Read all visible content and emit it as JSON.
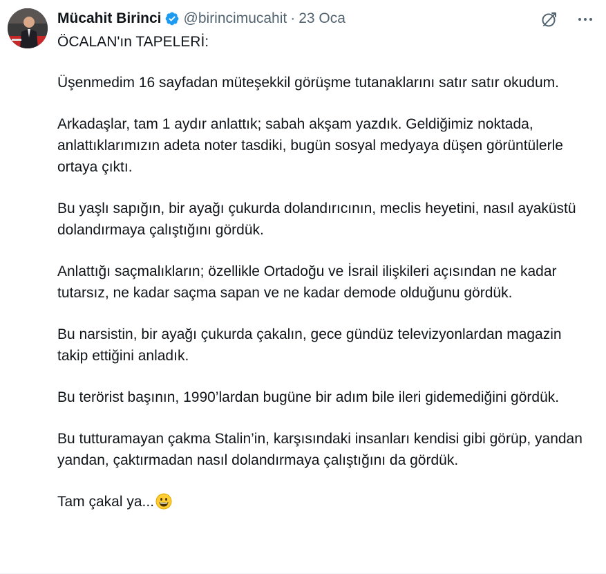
{
  "author": {
    "name": "Mücahit Birinci",
    "handle": "@birincimucahit",
    "separator": "·",
    "date": "23 Oca",
    "verified": true
  },
  "icons": {
    "verified": "verified-badge-icon",
    "grok": "grok-icon",
    "more": "more-icon",
    "emoji": "grinning-face-emoji"
  },
  "colors": {
    "verified_blue": "#1d9bf0",
    "text_primary": "#0f1419",
    "text_secondary": "#536471"
  },
  "tweet": {
    "paragraphs": [
      "ÖCALAN'ın TAPELERİ:",
      "Üşenmedim 16 sayfadan müteşekkil görüşme tutanaklarını satır satır okudum.",
      "Arkadaşlar, tam 1 aydır anlattık; sabah akşam yazdık. Geldiğimiz noktada, anlattıklarımızın adeta noter tasdiki, bugün sosyal medyaya düşen görüntülerle ortaya çıktı.",
      "Bu yaşlı sapığın, bir ayağı çukurda dolandırıcının, meclis heyetini, nasıl ayaküstü dolandırmaya çalıştığını gördük.",
      "Anlattığı saçmalıkların; özellikle Ortadoğu ve İsrail ilişkileri açısından ne kadar tutarsız, ne kadar saçma sapan ve ne kadar demode olduğunu gördük.",
      "Bu narsistin, bir ayağı çukurda çakalın, gece gündüz televizyonlardan magazin takip ettiğini anladık.",
      "Bu terörist başının, 1990’lardan bugüne bir adım bile ileri gidemediğini gördük.",
      "Bu tutturamayan çakma Stalin’in, karşısındaki insanları kendisi gibi görüp, yandan yandan, çaktırmadan nasıl dolandırmaya çalıştığını da gördük."
    ],
    "closing": "Tam çakal ya..."
  }
}
